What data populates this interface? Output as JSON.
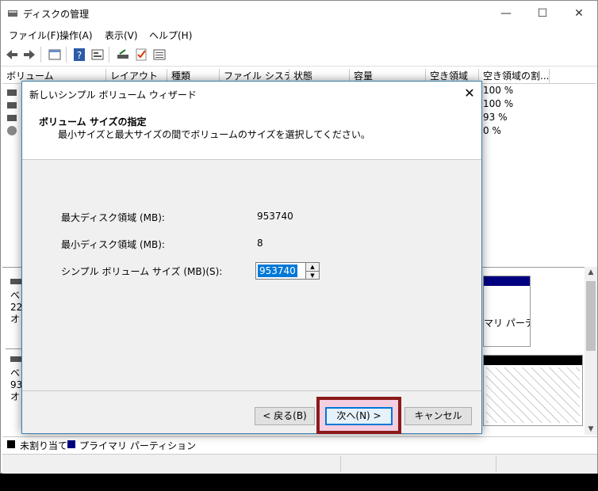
{
  "app": {
    "title": "ディスクの管理",
    "min_glyph": "—",
    "max_glyph": "☐",
    "close_glyph": "✕"
  },
  "menu": [
    {
      "label": "ファイル(F)"
    },
    {
      "label": "操作(A)"
    },
    {
      "label": "表示(V)"
    },
    {
      "label": "ヘルプ(H)"
    }
  ],
  "columns": [
    "ボリューム",
    "レイアウト",
    "種類",
    "ファイル システム",
    "状態",
    "容量",
    "空き領域",
    "空き領域の割..."
  ],
  "free_percent": [
    "100 %",
    "100 %",
    "93 %",
    "0 %"
  ],
  "lower_pane": {
    "disk0_lines": [
      "ベ",
      "22",
      "オン"
    ],
    "disk1_lines": [
      "ベ",
      "93",
      "オン"
    ],
    "partition_label": "マリ パーティ"
  },
  "legend": {
    "unallocated": "未割り当て",
    "primary": "プライマリ パーティション",
    "unallocated_color": "#000000",
    "primary_color": "#000080"
  },
  "dialog": {
    "title": "新しいシンプル ボリューム ウィザード",
    "close_glyph": "✕",
    "heading": "ボリューム サイズの指定",
    "subheading": "最小サイズと最大サイズの間でボリュームのサイズを選択してください。",
    "max_label": "最大ディスク領域 (MB):",
    "max_value": "953740",
    "min_label": "最小ディスク領域 (MB):",
    "min_value": "8",
    "size_label": "シンプル ボリューム サイズ (MB)(S):",
    "size_value": "953740",
    "back_button": "< 戻る(B)",
    "next_button": "次へ(N) >",
    "cancel_button": "キャンセル"
  },
  "colors": {
    "accent": "#0078d7",
    "highlight_border": "#8b1a1a"
  }
}
